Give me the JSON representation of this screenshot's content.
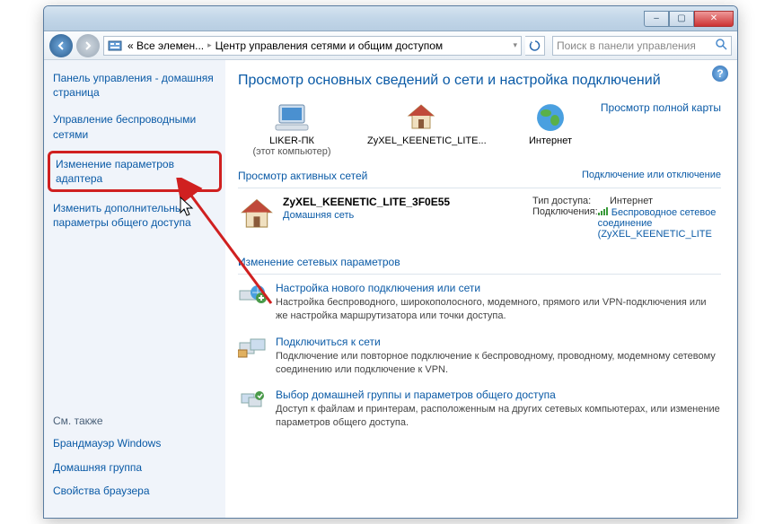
{
  "titlebar": {
    "minimize": "–",
    "maximize": "▢",
    "close": "✕"
  },
  "nav": {
    "breadcrumb_root": "Все элемен...",
    "breadcrumb_current": "Центр управления сетями и общим доступом",
    "search_placeholder": "Поиск в панели управления"
  },
  "sidebar": {
    "home": "Панель управления - домашняя страница",
    "items": [
      "Управление беспроводными сетями",
      "Изменение параметров адаптера",
      "Изменить дополнительные параметры общего доступа"
    ],
    "seealso_title": "См. также",
    "seealso": [
      "Брандмауэр Windows",
      "Домашняя группа",
      "Свойства браузера"
    ]
  },
  "content": {
    "heading": "Просмотр основных сведений о сети и настройка подключений",
    "full_map_link": "Просмотр полной карты",
    "map": {
      "computer_name": "LIKER-ПК",
      "computer_sub": "(этот компьютер)",
      "router_name": "ZyXEL_KEENETIC_LITE...",
      "internet_name": "Интернет"
    },
    "active_nets_title": "Просмотр активных сетей",
    "active_nets_link": "Подключение или отключение",
    "active_net": {
      "name": "ZyXEL_KEENETIC_LITE_3F0E55",
      "type_link": "Домашняя сеть",
      "access_label": "Тип доступа:",
      "access_value": "Интернет",
      "conn_label": "Подключения:",
      "conn_value_line1": "Беспроводное сетевое соединение",
      "conn_value_line2": "(ZyXEL_KEENETIC_LITE"
    },
    "change_params_title": "Изменение сетевых параметров",
    "tasks": [
      {
        "title": "Настройка нового подключения или сети",
        "desc": "Настройка беспроводного, широкополосного, модемного, прямого или VPN-подключения или же настройка маршрутизатора или точки доступа."
      },
      {
        "title": "Подключиться к сети",
        "desc": "Подключение или повторное подключение к беспроводному, проводному, модемному сетевому соединению или подключение к VPN."
      },
      {
        "title": "Выбор домашней группы и параметров общего доступа",
        "desc": "Доступ к файлам и принтерам, расположенным на других сетевых компьютерах, или изменение параметров общего доступа."
      }
    ]
  }
}
